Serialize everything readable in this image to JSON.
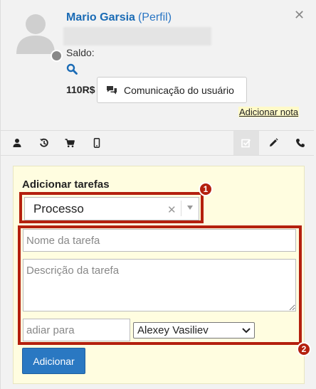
{
  "header": {
    "user_name": "Mario Garsia",
    "profile_link": "(Perfil)",
    "balance_label": "Saldo:",
    "balance_amount": "110R$",
    "communication_button": "Comunicação do usuário",
    "add_note": "Adicionar nota"
  },
  "tabs": [
    {
      "icon": "user-icon"
    },
    {
      "icon": "history-icon"
    },
    {
      "icon": "cart-icon"
    },
    {
      "icon": "mobile-icon"
    },
    {
      "icon": "task-icon",
      "active": true
    },
    {
      "icon": "pencil-icon"
    },
    {
      "icon": "phone-icon"
    }
  ],
  "form": {
    "title": "Adicionar tarefas",
    "process_value": "Processo",
    "task_name_placeholder": "Nome da tarefa",
    "task_description_placeholder": "Descrição da tarefa",
    "defer_placeholder": "adiar para",
    "assignee_value": "Alexey Vasiliev",
    "submit_label": "Adicionar"
  },
  "annotations": [
    {
      "label": "1"
    },
    {
      "label": "2"
    }
  ],
  "colors": {
    "link_blue": "#1a6bb5",
    "primary_button": "#2a78c2",
    "form_background": "#fffde0",
    "annotation_red": "#b4200e"
  }
}
